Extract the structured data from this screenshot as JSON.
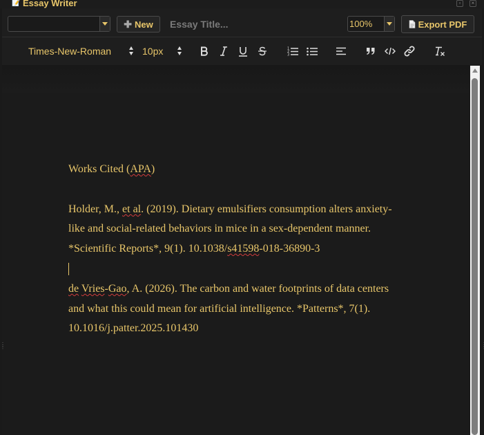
{
  "window": {
    "icon": "📝",
    "title": "Essay Writer"
  },
  "toolbar": {
    "document_select_value": "",
    "new_label": "New",
    "title_placeholder": "Essay Title...",
    "zoom_value": "100%",
    "export_label": "Export PDF"
  },
  "format_bar": {
    "font": "Times-New-Roman",
    "size": "10px",
    "buttons": [
      "bold",
      "italic",
      "underline",
      "strikethrough",
      "ordered-list",
      "bullet-list",
      "align-left",
      "blockquote",
      "code",
      "link",
      "clear-format"
    ]
  },
  "document": {
    "heading": {
      "pre": "Works Cited (",
      "sq": "APA",
      "post": ")"
    },
    "ref1": {
      "line1": {
        "pre": "Holder, M., ",
        "sq": "et al",
        "post": ". (2019). Dietary emulsifiers consumption alters anxiety-"
      },
      "line2": "like and social-related behaviors in mice in a sex-dependent manner.",
      "line3": {
        "pre": "*Scientific Reports*, 9(1). 10.1038/",
        "sq": "s41598",
        "post": "-018-36890-3"
      }
    },
    "ref2": {
      "line1": {
        "sq1": "de",
        "mid1": " ",
        "sq2": "Vries",
        "mid2": "-",
        "sq3": "Gao",
        "post": ", A. (2026). The carbon and water footprints of data centers"
      },
      "line2": "and what this could mean for artificial intelligence. *Patterns*, 7(1).",
      "line3": "10.1016/j.patter.2025.101430"
    }
  }
}
